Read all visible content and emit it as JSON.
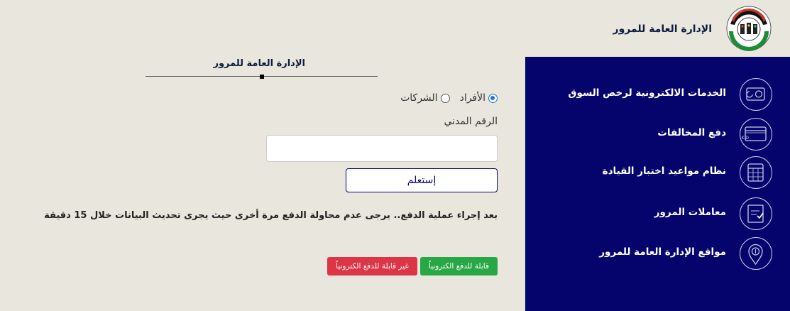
{
  "header": {
    "org_name": "الإدارة العامة للمرور"
  },
  "sidebar": {
    "items": [
      {
        "label": "الخدمات الالكترونية لرخص السوق",
        "icon": "card-icon"
      },
      {
        "label": "دفع المخالفات",
        "icon": "payment-card-icon",
        "icon_text": "K.D"
      },
      {
        "label": "نظام مواعيد اختبار القيادة",
        "icon": "calendar-icon"
      },
      {
        "label": "معاملات المرور",
        "icon": "document-check-icon"
      },
      {
        "label": "مواقع الإدارة العامة للمرور",
        "icon": "location-pin-icon"
      }
    ]
  },
  "main": {
    "title": "الإدارة العامة للمرور",
    "radio": {
      "individuals": "الأفراد",
      "companies": "الشركات",
      "selected": "individuals"
    },
    "civil_id_label": "الرقم المدني",
    "civil_id_value": "",
    "inquire_button": "إستعلم",
    "notice": "بعد إجراء عملية الدفع.. يرجى عدم محاولة الدفع مرة أخرى حيث يجرى تحديث البيانات خلال 15 دقيقة",
    "payable_badge": "قابلة للدفع الكترونياً",
    "not_payable_badge": "غير قابلة للدفع الكترونياً"
  },
  "colors": {
    "background": "#e9e6dd",
    "sidebar": "#04046c",
    "payable": "#28a745",
    "not_payable": "#dc3545"
  }
}
